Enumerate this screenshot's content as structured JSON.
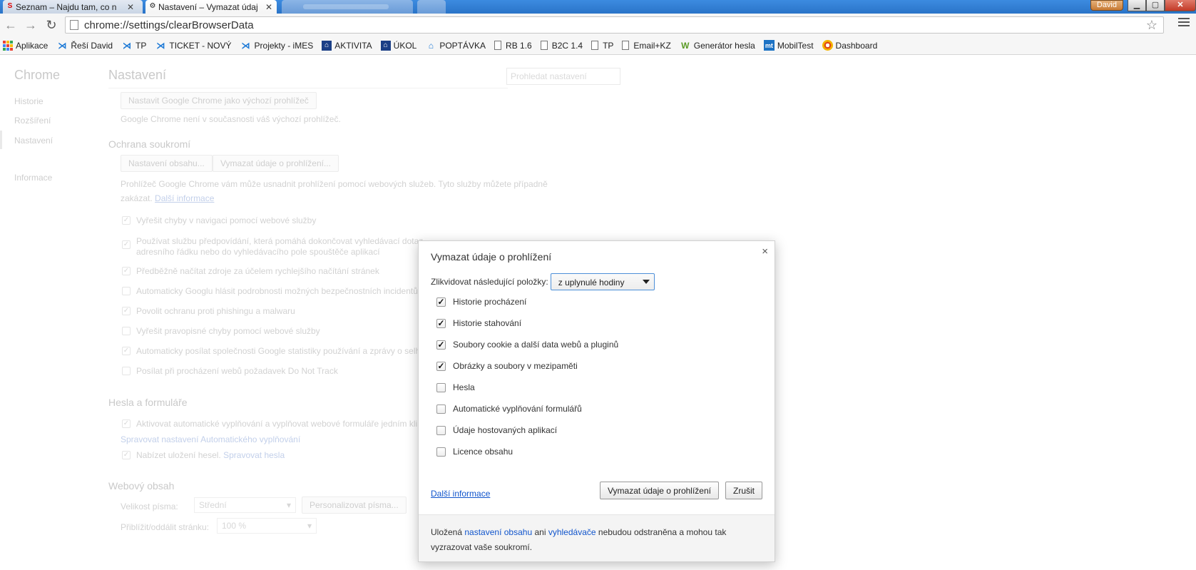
{
  "tabs": [
    {
      "title": "Seznam – Najdu tam, co n",
      "favicon": "seznam-logo-icon"
    },
    {
      "title": "Nastavení – Vymazat údaj",
      "favicon": "gear-icon"
    }
  ],
  "window": {
    "user": "David"
  },
  "omnibox": {
    "url": "chrome://settings/clearBrowserData"
  },
  "bookmarks": [
    {
      "label": "Aplikace",
      "icon": "apps-grid-icon"
    },
    {
      "label": "Řeší David",
      "icon": "jira-icon"
    },
    {
      "label": "TP",
      "icon": "jira-icon"
    },
    {
      "label": "TICKET - NOVÝ",
      "icon": "jira-icon"
    },
    {
      "label": "Projekty - iMES",
      "icon": "jira-icon"
    },
    {
      "label": "AKTIVITA",
      "icon": "aktivita-icon"
    },
    {
      "label": "ÚKOL",
      "icon": "aktivita-icon"
    },
    {
      "label": "POPTÁVKA",
      "icon": "poptavka-icon"
    },
    {
      "label": "RB 1.6",
      "icon": "page-icon"
    },
    {
      "label": "B2C 1.4",
      "icon": "page-icon"
    },
    {
      "label": "TP",
      "icon": "page-icon"
    },
    {
      "label": "Email+KZ",
      "icon": "page-icon"
    },
    {
      "label": "Generátor hesla",
      "icon": "generator-icon"
    },
    {
      "label": "MobilTest",
      "icon": "mobiltest-icon"
    },
    {
      "label": "Dashboard",
      "icon": "dashboard-icon"
    }
  ],
  "settings": {
    "sidebar": {
      "title": "Chrome",
      "items": [
        "Historie",
        "Rozšíření",
        "Nastavení",
        "Informace"
      ]
    },
    "title": "Nastavení",
    "search_placeholder": "Prohledat nastavení",
    "default_browser_button": "Nastavit Google Chrome jako výchozí prohlížeč",
    "default_browser_note": "Google Chrome není v současnosti váš výchozí prohlížeč.",
    "privacy": {
      "heading": "Ochrana soukromí",
      "content_button": "Nastavení obsahu...",
      "clear_button": "Vymazat údaje o prohlížení...",
      "desc_line1": "Prohlížeč Google Chrome vám může usnadnit prohlížení pomocí webových služeb. Tyto služby můžete případně",
      "desc_line2": "zakázat.",
      "more_info": "Další informace",
      "options": [
        {
          "label": "Vyřešit chyby v navigaci pomocí webové služby",
          "checked": true
        },
        {
          "label": "Používat službu předpovídání, která pomáhá dokončovat vyhledávací dotaz",
          "label2": "adresního řádku nebo do vyhledávacího pole spouštěče aplikací",
          "checked": true
        },
        {
          "label": "Předběžně načítat zdroje za účelem rychlejšího načítání stránek",
          "checked": true
        },
        {
          "label": "Automaticky Googlu hlásit podrobnosti možných bezpečnostních incidentů",
          "checked": false
        },
        {
          "label": "Povolit ochranu proti phishingu a malwaru",
          "checked": true
        },
        {
          "label": "Vyřešit pravopisné chyby pomocí webové služby",
          "checked": false
        },
        {
          "label": "Automaticky posílat společnosti Google statistiky používání a zprávy o selh",
          "checked": true
        },
        {
          "label": "Posílat při procházení webů požadavek Do Not Track",
          "checked": false
        }
      ]
    },
    "passwords": {
      "heading": "Hesla a formuláře",
      "autofill": "Aktivovat automatické vyplňování a vyplňovat webové formuláře jedním kli",
      "autofill_link": "Spravovat nastavení Automatického vyplňování",
      "save_passwords": "Nabízet uložení hesel.",
      "manage_passwords": "Spravovat hesla"
    },
    "web_content": {
      "heading": "Webový obsah",
      "font_size_label": "Velikost písma:",
      "font_size_value": "Střední",
      "customize_fonts": "Personalizovat písma...",
      "zoom_label": "Přiblížit/oddálit stránku:",
      "zoom_value": "100 %"
    }
  },
  "dialog": {
    "title": "Vymazat údaje o prohlížení",
    "close": "×",
    "range_label": "Zlikvidovat následující položky:",
    "range_value": "z uplynulé hodiny",
    "items": [
      {
        "label": "Historie procházení",
        "checked": true
      },
      {
        "label": "Historie stahování",
        "checked": true
      },
      {
        "label": "Soubory cookie a další data webů a pluginů",
        "checked": true
      },
      {
        "label": "Obrázky a soubory v mezipaměti",
        "checked": true
      },
      {
        "label": "Hesla",
        "checked": false
      },
      {
        "label": "Automatické vyplňování formulářů",
        "checked": false
      },
      {
        "label": "Údaje hostovaných aplikací",
        "checked": false
      },
      {
        "label": "Licence obsahu",
        "checked": false
      }
    ],
    "more_info": "Další informace",
    "clear_button": "Vymazat údaje o prohlížení",
    "cancel_button": "Zrušit",
    "footer": {
      "prefix": "Uložená",
      "link1": "nastavení obsahu",
      "middle": "ani",
      "link2": "vyhledávače",
      "suffix": "nebudou odstraněna a mohou tak",
      "line2": "vyzrazovat vaše soukromí."
    }
  },
  "colors": {
    "accent": "#1155cc",
    "tabstrip": "#2a74c8",
    "select_border": "#4d8fd8"
  }
}
